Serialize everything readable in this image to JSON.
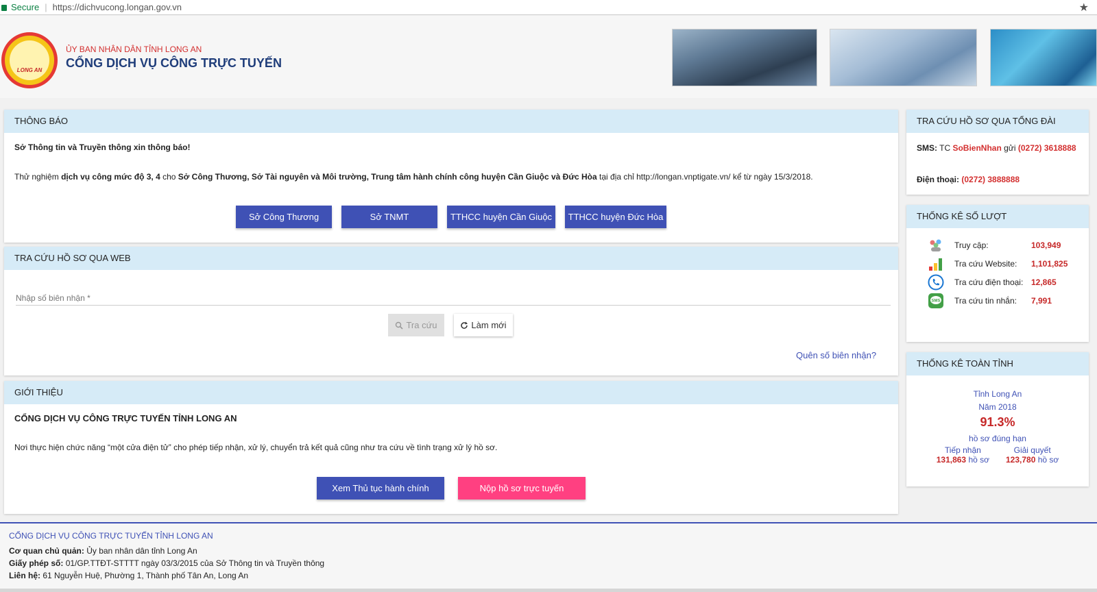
{
  "browser": {
    "secure_label": "Secure",
    "url": "https://dichvucong.longan.gov.vn",
    "star_icon": "★"
  },
  "header": {
    "logo_text": "LONG AN",
    "org_name": "ỦY BAN NHÂN DÂN TỈNH LONG AN",
    "portal_name": "CỔNG DỊCH VỤ CÔNG TRỰC TUYẾN"
  },
  "notice": {
    "heading": "THÔNG BÁO",
    "title": "Sở Thông tin và Truyền thông xin thông báo!",
    "body_pre": "Thử nghiệm ",
    "body_b1": "dịch vụ công mức độ 3, 4",
    "body_mid": " cho ",
    "body_b2": "Sở Công Thương, Sở Tài nguyên và Môi trường, Trung tâm hành chính công huyện Cần Giuộc và Đức Hòa",
    "body_post": " tại địa chỉ http://longan.vnptigate.vn/ kể từ ngày 15/3/2018.",
    "buttons": [
      "Sở Công Thương",
      "Sở TNMT",
      "TTHCC huyện Cần Giuộc",
      "TTHCC huyện Đức Hòa"
    ]
  },
  "web_search": {
    "heading": "TRA CỨU HỒ SƠ QUA WEB",
    "placeholder": "Nhập số biên nhận *",
    "search_label": "Tra cứu",
    "reset_label": "Làm mới",
    "forgot_link": "Quên số biên nhận?"
  },
  "intro": {
    "heading": "GIỚI THIỆU",
    "title": "CỔNG DỊCH VỤ CÔNG TRỰC TUYẾN TỈNH LONG AN",
    "body": "Nơi thực hiện chức năng “một cửa điện tử” cho phép tiếp nhận, xử lý, chuyển trả kết quả cũng như tra cứu về tình trạng xử lý hồ sơ.",
    "btn_procedures": "Xem Thủ tục hành chính",
    "btn_submit": "Nộp hồ sơ trực tuyến"
  },
  "phone_lookup": {
    "heading": "TRA CỨU HỒ SƠ QUA TỔNG ĐÀI",
    "sms_label": "SMS:",
    "sms_tc": " TC ",
    "sms_keyword": "SoBienNhan",
    "sms_send": " gửi ",
    "sms_number": "(0272) 3618888",
    "tel_label": "Điện thoại:",
    "tel_number": "(0272) 3888888"
  },
  "stats": {
    "heading": "THỐNG KÊ SỐ LƯỢT",
    "rows": [
      {
        "icon": "users-icon",
        "label": "Truy cập:",
        "value": "103,949"
      },
      {
        "icon": "bar-chart-icon",
        "label": "Tra cứu Website:",
        "value": "1,101,825"
      },
      {
        "icon": "phone-icon",
        "label": "Tra cứu điện thoại:",
        "value": "12,865"
      },
      {
        "icon": "sms-icon",
        "label": "Tra cứu tin nhắn:",
        "value": "7,991"
      }
    ]
  },
  "province": {
    "heading": "THỐNG KÊ TOÀN TỈNH",
    "name": "Tỉnh Long An",
    "year": "Năm 2018",
    "percent": "91.3%",
    "ontime": "hồ sơ đúng hạn",
    "received_label": "Tiếp nhận",
    "received_value": "131,863",
    "resolved_label": "Giải quyết",
    "resolved_value": "123,780",
    "unit": " hồ sơ"
  },
  "footer": {
    "title": "CỔNG DỊCH VỤ CÔNG TRỰC TUYẾN TỈNH LONG AN",
    "owner_label": "Cơ quan chủ quản:",
    "owner_value": " Ủy ban nhân dân tỉnh Long An",
    "license_label": "Giấy phép số:",
    "license_value": " 01/GP.TTĐT-STTTT ngày 03/3/2015 của Sở Thông tin và Truyền thông",
    "contact_label": "Liên hệ:",
    "contact_value": " 61 Nguyễn Huệ, Phường 1, Thành phố Tân An, Long An"
  },
  "colors": {
    "primary": "#3f51b5",
    "accent": "#ff4081",
    "panel_header": "#d6ebf7",
    "highlight_red": "#c62828"
  }
}
